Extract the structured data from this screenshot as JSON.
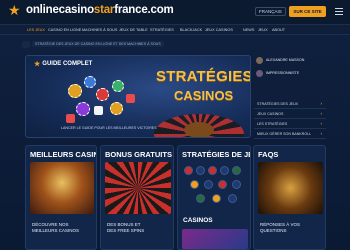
{
  "header": {
    "logo_prefix": "onlinecasino",
    "logo_accent": "star",
    "logo_suffix": "france.com",
    "language": "FRANÇAIS",
    "cta_label": "SUR CE SITE"
  },
  "nav": {
    "items": [
      "LES JEUX",
      "CASINO EN LIGNE",
      "MACHINES À SOUS",
      "JEUX DE TABLE",
      "STRATÉGIES",
      "BLACKJACK",
      "JEUX CASINOS",
      "NEWS",
      "JEUX",
      "ABOUT"
    ]
  },
  "breadcrumbs": [
    "STRATÉGIE DES JEUX DE CASINO EN LIGNE ET DES MACHINES À SOUS"
  ],
  "hero": {
    "label": "GUIDE COMPLET",
    "title_line1": "STRATÉGIES",
    "title_line2": "CASINOS",
    "caption": "LANCER LE GUIDE POUR LES MEILLEURES VICTOIRES"
  },
  "side": {
    "users": [
      "ALEXANDRE MASSON",
      "IMPRESSIONNISTE"
    ],
    "links": [
      "STRATÉGIES DES JEUX",
      "JEUX CASINOS",
      "LES STRATÉGIES",
      "MIEUX GÉRER SON BANKROLL"
    ]
  },
  "cards": [
    {
      "title": "MEILLEURS CASINOS",
      "text_lines": [
        "DÉCOUVRE NOS",
        "MEILLEURS CASINOS"
      ]
    },
    {
      "title": "BONUS GRATUITS",
      "text_lines": [
        "DES BONUS ET",
        "DES FREE SPINS"
      ]
    },
    {
      "title": "STRATÉGIES DE JEU",
      "subtitle": "CASINOS"
    },
    {
      "title": "FAQS",
      "text_lines": [
        "RÉPONSES À VOS",
        "QUESTIONS"
      ]
    }
  ],
  "colors": {
    "accent": "#f0a020",
    "background": "#0d1b33",
    "card": "#12264a"
  }
}
